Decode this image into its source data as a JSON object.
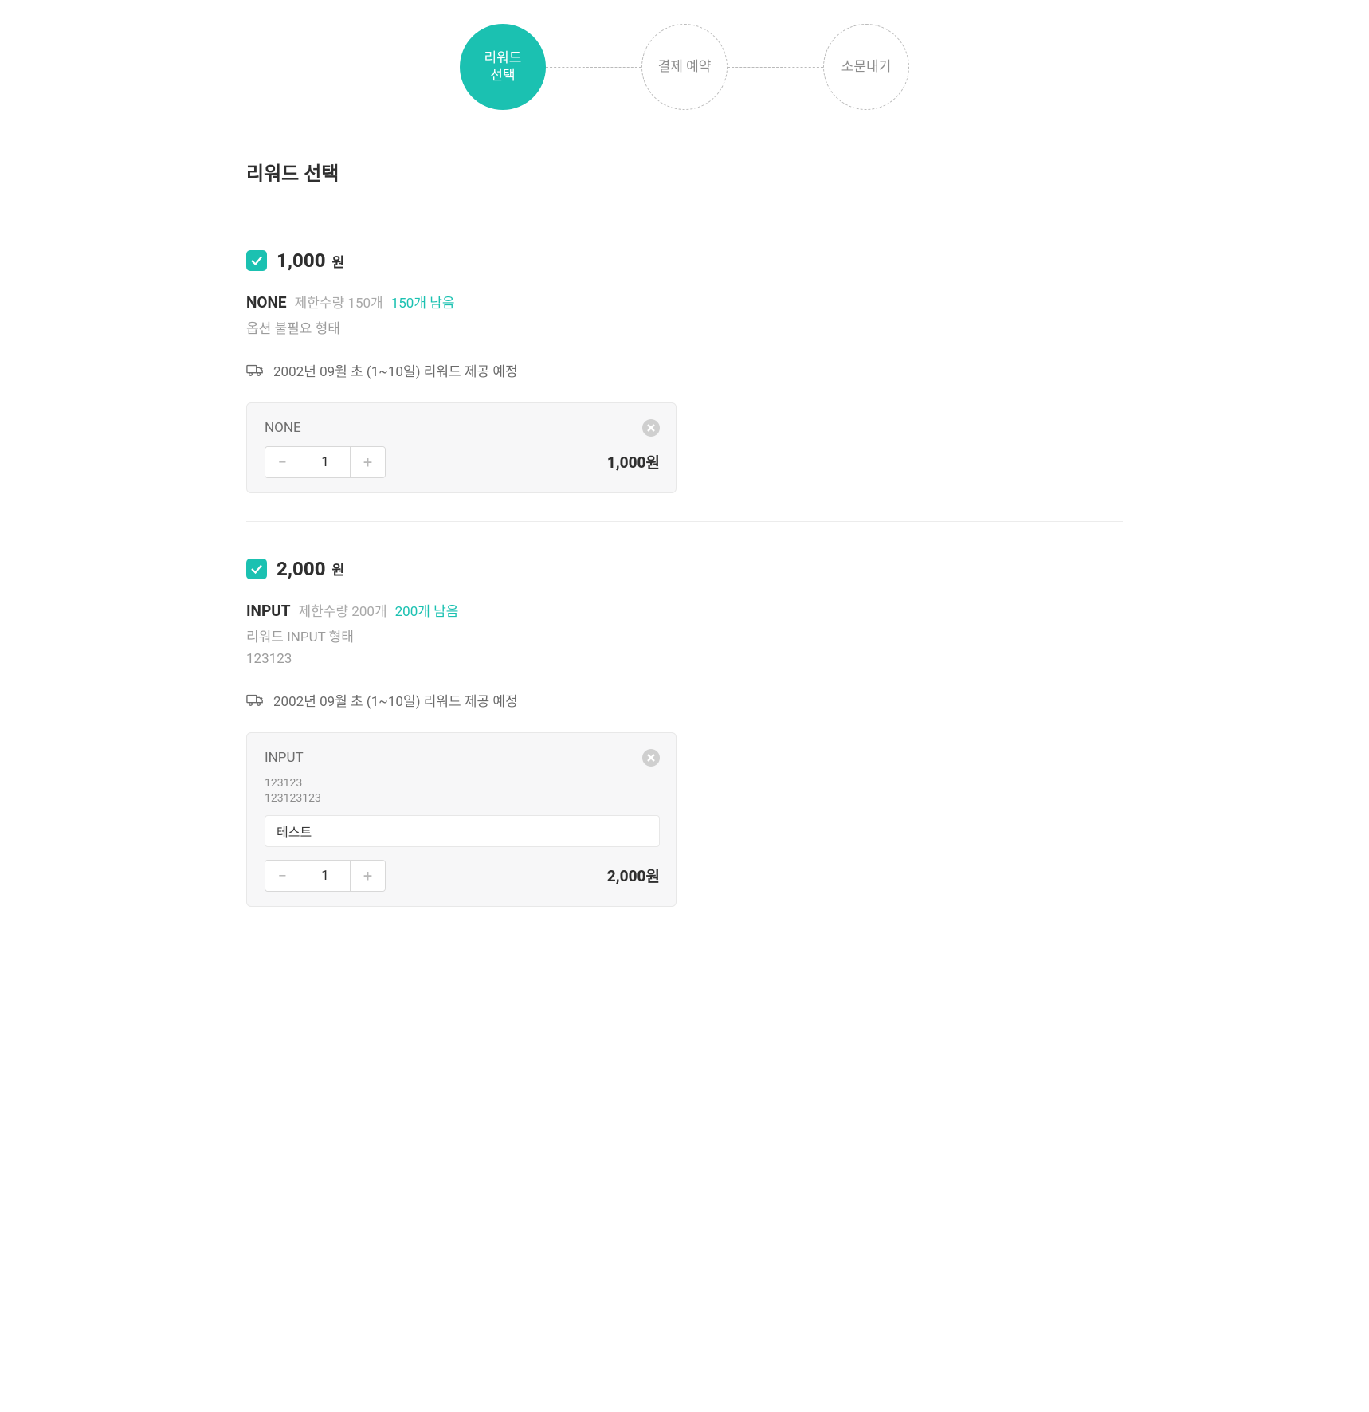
{
  "stepper": {
    "steps": [
      {
        "label": "리워드\n선택",
        "active": true
      },
      {
        "label": "결제 예약",
        "active": false
      },
      {
        "label": "소문내기",
        "active": false
      }
    ]
  },
  "section_title": "리워드 선택",
  "currency_unit": "원",
  "rewards": [
    {
      "price": "1,000",
      "name": "NONE",
      "limit_text": "제한수량 150개",
      "remain_text": "150개 남음",
      "desc_lines": [
        "옵션 불필요 형태"
      ],
      "delivery_text": "2002년 09월 초 (1~10일) 리워드 제공 예정",
      "selection": {
        "title": "NONE",
        "sub_lines": [],
        "input_value": null,
        "quantity": "1",
        "subtotal": "1,000원"
      }
    },
    {
      "price": "2,000",
      "name": "INPUT",
      "limit_text": "제한수량 200개",
      "remain_text": "200개 남음",
      "desc_lines": [
        "리워드 INPUT 형태",
        "123123"
      ],
      "delivery_text": "2002년 09월 초 (1~10일) 리워드 제공 예정",
      "selection": {
        "title": "INPUT",
        "sub_lines": [
          "123123",
          "123123123"
        ],
        "input_value": "테스트",
        "quantity": "1",
        "subtotal": "2,000원"
      }
    }
  ]
}
